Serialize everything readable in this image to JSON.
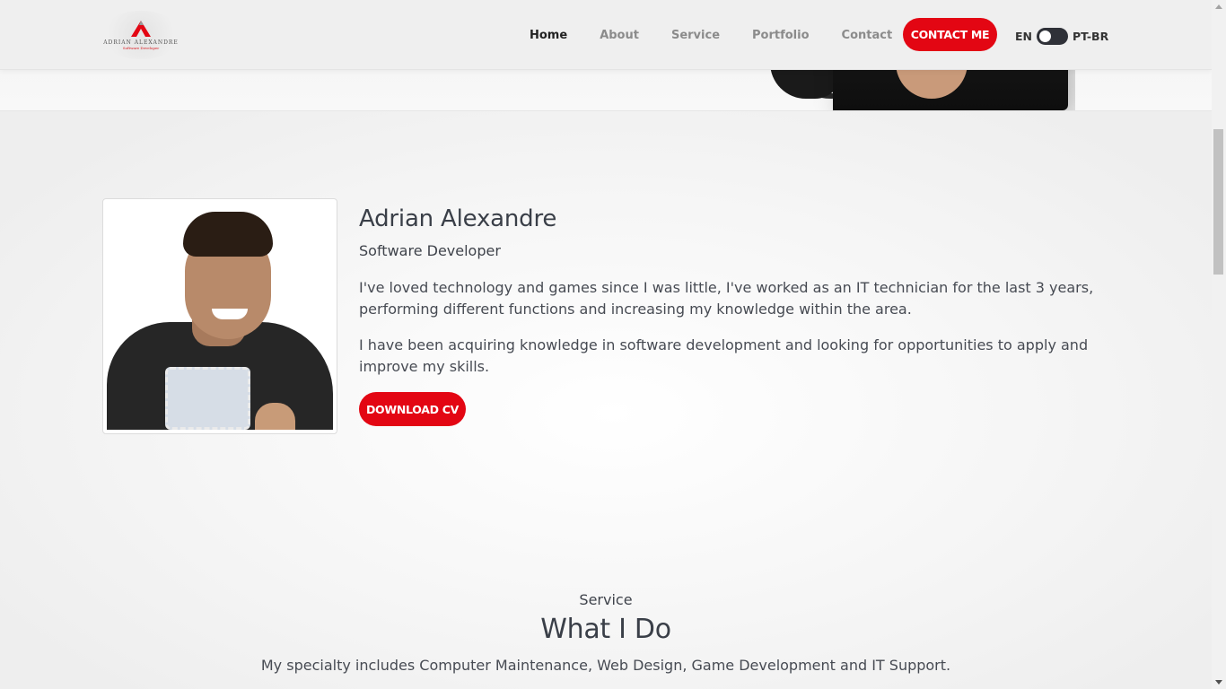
{
  "brand": {
    "logo_name": "ADRIAN ALEXANDRE",
    "logo_subtitle": "Software Developer",
    "accent_color": "#e30613"
  },
  "nav": {
    "items": [
      {
        "label": "Home",
        "active": true
      },
      {
        "label": "About",
        "active": false
      },
      {
        "label": "Service",
        "active": false
      },
      {
        "label": "Portfolio",
        "active": false
      },
      {
        "label": "Contact",
        "active": false
      }
    ],
    "contact_button": "CONTACT ME",
    "lang_left": "EN",
    "lang_right": "PT-BR"
  },
  "about": {
    "name": "Adrian Alexandre",
    "role": "Software Developer",
    "paragraph_1": "I've loved technology and games since I was little, I've worked as an IT technician for the last 3 years, performing different functions and increasing my knowledge within the area.",
    "paragraph_2": "I have been acquiring knowledge in software development and looking for opportunities to apply and improve my skills.",
    "download_button": "DOWNLOAD CV"
  },
  "service": {
    "subtitle": "Service",
    "title": "What I Do",
    "description": "My specialty includes Computer Maintenance, Web Design, Game Development and IT Support."
  }
}
